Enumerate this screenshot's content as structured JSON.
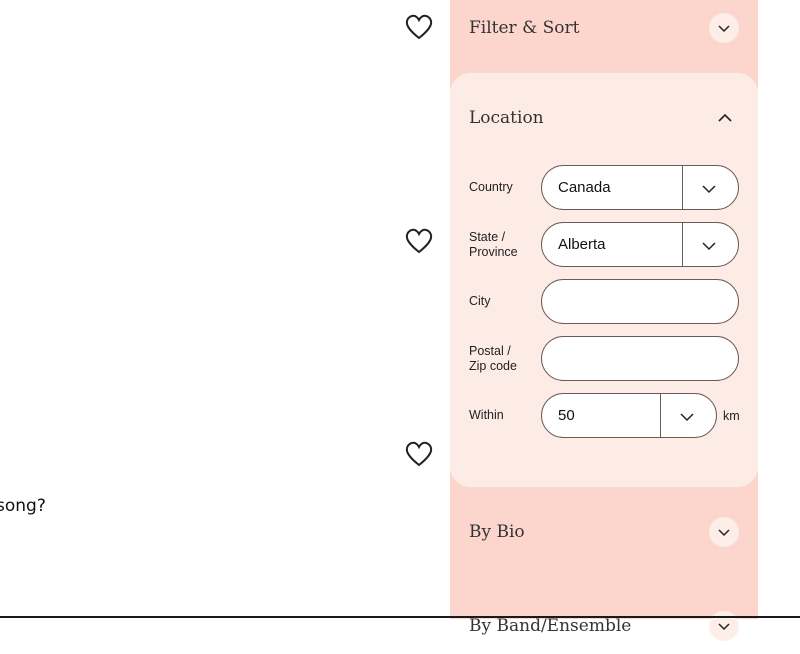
{
  "left": {
    "partial_text": "song?"
  },
  "panel": {
    "filter_sort": {
      "title": "Filter & Sort",
      "icon": "chevron-down-icon"
    },
    "location": {
      "title": "Location",
      "icon": "chevron-up-icon",
      "fields": {
        "country": {
          "label": "Country",
          "value": "Canada"
        },
        "state": {
          "label_line1": "State /",
          "label_line2": "Province",
          "value": "Alberta"
        },
        "city": {
          "label": "City",
          "value": ""
        },
        "postal": {
          "label_line1": "Postal /",
          "label_line2": "Zip code",
          "value": ""
        },
        "within": {
          "label": "Within",
          "value": "50",
          "unit": "km"
        }
      }
    },
    "by_bio": {
      "title": "By Bio",
      "icon": "chevron-down-icon"
    },
    "next_section": {
      "title": "By Band/Ensemble"
    }
  },
  "colors": {
    "panel_bg": "#fcd6cc",
    "card_bg": "#fdece6",
    "border": "#6b5a56"
  }
}
